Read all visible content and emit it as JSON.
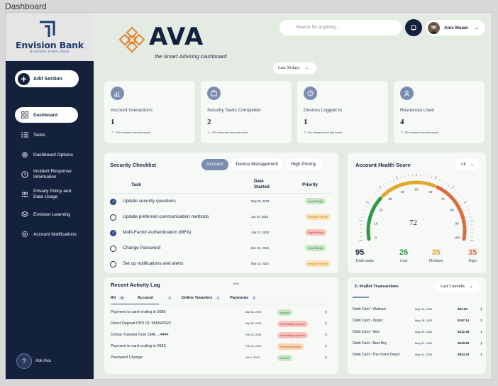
{
  "window_title": "Dashboard",
  "brand": {
    "name": "Envision Bank",
    "tagline": "BANKING SIMPLIFIED"
  },
  "sidebar": {
    "add_label": "Add Section",
    "items": [
      {
        "label": "Dashboard",
        "icon": "grid-icon"
      },
      {
        "label": "Tasks",
        "icon": "list-icon"
      },
      {
        "label": "Dashboard Options",
        "icon": "gear-icon"
      },
      {
        "label": "Incident Response Information",
        "icon": "clock-icon"
      },
      {
        "label": "Privacy Policy and Data Usage",
        "icon": "people-icon"
      },
      {
        "label": "Envision Learning",
        "icon": "layers-icon"
      },
      {
        "label": "Account Notifications",
        "icon": "settings-icon"
      }
    ],
    "ask_label": "Ask Ava"
  },
  "header": {
    "app_name": "AVA",
    "subtitle": "the Smart Advising Dashboard",
    "search_placeholder": "Search for anything...",
    "user_name": "Alex Meian"
  },
  "date_filter": "Last 30 days",
  "stats": [
    {
      "label": "Account Interactions",
      "value": "1",
      "trend": "10% increase from last month",
      "icon": "bar-chart-icon"
    },
    {
      "label": "Security Tasks Completed",
      "value": "2",
      "trend": "10% decrease from last month",
      "icon": "briefcase-icon"
    },
    {
      "label": "Devices Logged In",
      "value": "1",
      "trend": "8% increase from last month",
      "icon": "clock-icon"
    },
    {
      "label": "Resources Used",
      "value": "4",
      "trend": "2% increase from last month",
      "icon": "user-icon"
    }
  ],
  "checklist": {
    "title": "Security Checklist",
    "tabs": [
      "Account",
      "Device Management",
      "High Priority"
    ],
    "columns": {
      "task": "Task",
      "date": "Date Started",
      "priority": "Priority"
    },
    "rows": [
      {
        "task": "Update security questions",
        "date": "May 25, 2023",
        "priority": "Low Priority",
        "level": "low",
        "done": true
      },
      {
        "task": "Update preferred communication methods",
        "date": "Jun 20, 2023",
        "priority": "Medium Priority",
        "level": "med",
        "done": false
      },
      {
        "task": "Multi-Factor Authentication (MFA)",
        "date": "July 13, 2023",
        "priority": "High Priority",
        "level": "high",
        "done": true
      },
      {
        "task": "Change Password",
        "date": "Dec 20, 2023",
        "priority": "Low Priority",
        "level": "low",
        "done": false
      },
      {
        "task": "Set up notifications and alerts",
        "date": "Mar 15, 2023",
        "priority": "Medium Priority",
        "level": "med",
        "done": false
      }
    ]
  },
  "health": {
    "title": "Account Health Score",
    "filter": "All",
    "score": "72",
    "ticks": [
      "0",
      "10",
      "20",
      "30",
      "40",
      "50",
      "60",
      "70",
      "80",
      "90",
      "100"
    ],
    "summary": [
      {
        "value": "95",
        "label": "Total tasks",
        "color": "#14213d"
      },
      {
        "value": "26",
        "label": "Low",
        "color": "#2e9a47"
      },
      {
        "value": "35",
        "label": "Medium",
        "color": "#e0a82e"
      },
      {
        "value": "35",
        "label": "High",
        "color": "#e06a3a"
      }
    ]
  },
  "activity": {
    "title": "Recent Activity Log",
    "percent": "100%",
    "tabs": [
      {
        "label": "All",
        "count": "50"
      },
      {
        "label": "Account",
        "count": "4"
      },
      {
        "label": "Online Transfers",
        "count": "1"
      },
      {
        "label": "Payments",
        "count": "3"
      }
    ],
    "rows": [
      {
        "name": "Payment to card ending in 0085",
        "date": "Mar 15, 2023",
        "status": "Secure",
        "kind": "secure"
      },
      {
        "name": "Direct Deposit PPD ID: 996543322",
        "date": "Mar 02, 2023",
        "status": "Potentially insecure",
        "kind": "insecure"
      },
      {
        "name": "Online Transfer from CHK....4444",
        "date": "Feb 20, 2023",
        "status": "Potentially insecure",
        "kind": "insecure"
      },
      {
        "name": "Payment to card ending in 5555",
        "date": "Feb 15, 2023",
        "status": "Pending Review",
        "kind": "pending"
      },
      {
        "name": "Password Change",
        "date": "Jun 1, 2023",
        "status": "Secure",
        "kind": "secure"
      }
    ]
  },
  "wallet": {
    "title": "E-Wallet Transactions",
    "filter": "Last 5 months",
    "rows": [
      {
        "name": "Debit Card - Walmart",
        "date": "May 25, 2023",
        "amount": "$53.29"
      },
      {
        "name": "Debit Card - Target",
        "date": "May 26, 2023",
        "amount": "$167.14"
      },
      {
        "name": "Debit Card - Ikea",
        "date": "May 26, 2023",
        "amount": "$412.38"
      },
      {
        "name": "Debit Card - Best Buy",
        "date": "May 31, 2023",
        "amount": "$649.99"
      },
      {
        "name": "Debit Card - The Home Depot",
        "date": "May 31, 2023",
        "amount": "$824.43"
      }
    ]
  },
  "colors": {
    "navy": "#14213d",
    "accent": "#7a8db1",
    "background": "#e3ebe2",
    "low": "#2e9a47",
    "medium": "#e0a82e",
    "high": "#e06a3a"
  }
}
